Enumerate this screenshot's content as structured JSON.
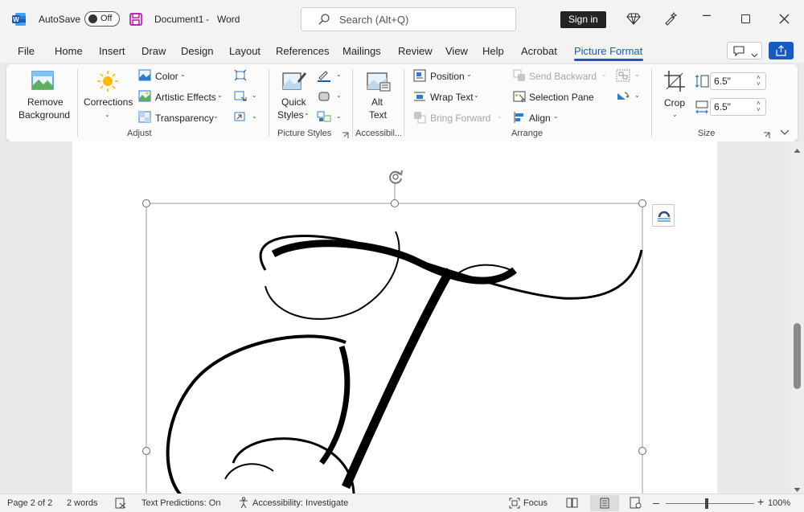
{
  "titlebar": {
    "autosave_label": "AutoSave",
    "autosave_state": "Off",
    "doc_title": "Document1",
    "app_name": "Word",
    "search_placeholder": "Search (Alt+Q)",
    "sign_in": "Sign in"
  },
  "tabs": [
    "File",
    "Home",
    "Insert",
    "Draw",
    "Design",
    "Layout",
    "References",
    "Mailings",
    "Review",
    "View",
    "Help",
    "Acrobat",
    "Picture Format"
  ],
  "active_tab": "Picture Format",
  "ribbon": {
    "adjust": {
      "remove_background": [
        "Remove",
        "Background"
      ],
      "corrections": "Corrections",
      "color": "Color",
      "artistic_effects": "Artistic Effects",
      "transparency": "Transparency",
      "group_label": "Adjust"
    },
    "picture_styles": {
      "quick_styles": [
        "Quick",
        "Styles"
      ],
      "group_label": "Picture Styles"
    },
    "accessibility": {
      "alt_text": [
        "Alt",
        "Text"
      ],
      "group_label": "Accessibil..."
    },
    "arrange": {
      "position": "Position",
      "wrap_text": "Wrap Text",
      "bring_forward": "Bring Forward",
      "send_backward": "Send Backward",
      "selection_pane": "Selection Pane",
      "align": "Align",
      "group_label": "Arrange"
    },
    "size": {
      "crop": "Crop",
      "height": "6.5\"",
      "width": "6.5\"",
      "group_label": "Size"
    }
  },
  "status": {
    "page": "Page 2 of 2",
    "words": "2 words",
    "text_predictions": "Text Predictions: On",
    "accessibility": "Accessibility: Investigate",
    "focus": "Focus",
    "zoom": "100%"
  },
  "colors": {
    "accent": "#185abd",
    "word_brand": "#185abd",
    "sign_in_bg": "#242424"
  }
}
